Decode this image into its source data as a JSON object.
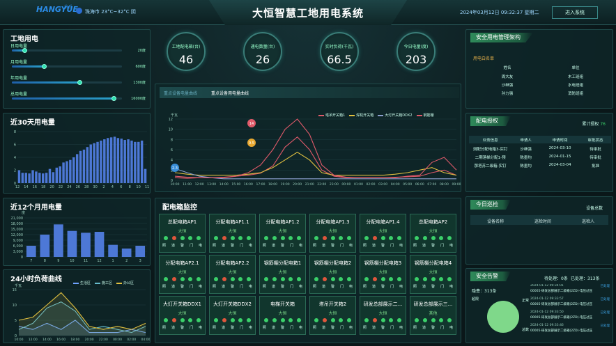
{
  "header": {
    "brand": "HANGYUE",
    "brand_cn": "杭岳",
    "weather": "珠海市 23°C~32°C 阴",
    "title": "大恒智慧工地用电系统",
    "datetime": "2024年03月12日 09:32:37 星期二",
    "enter_button": "进入系统"
  },
  "site_power": {
    "title": "工地用电",
    "rows": [
      {
        "label": "日用电量",
        "value": "20度",
        "fraction": 0.12
      },
      {
        "label": "月用电量",
        "value": "600度",
        "fraction": 0.3
      },
      {
        "label": "年用电量",
        "value": "1300度",
        "fraction": 0.62
      },
      {
        "label": "总用电量",
        "value": "16000度",
        "fraction": 0.93
      }
    ]
  },
  "daily30": {
    "title": "近30天用电量"
  },
  "monthly12": {
    "title": "近12个月用电量"
  },
  "load24": {
    "title": "24小时负荷曲线",
    "legend": [
      "生活区",
      "施工区",
      "办公区"
    ]
  },
  "gauges": [
    {
      "label": "工地配电箱(台)",
      "value": "46"
    },
    {
      "label": "通电数量(台)",
      "value": "26"
    },
    {
      "label": "实时负荷(千瓦)",
      "value": "66.5"
    },
    {
      "label": "今日电量(度)",
      "value": "203"
    }
  ],
  "trend": {
    "tabs": [
      "重点设备电量曲线",
      "重点设备用电量曲线"
    ],
    "unit": "千瓦",
    "legend": [
      "塔吊开关箱1",
      "焊机开关箱",
      "大灯开关箱DDX2",
      "钢筋棚"
    ],
    "markers": [
      "14",
      "9.5",
      "2.3"
    ]
  },
  "cabinets": {
    "title": "配电箱监控",
    "dot_labels": [
      "照",
      "道",
      "警",
      "门",
      "电"
    ],
    "items": [
      {
        "name": "总配电箱AP1",
        "status": "大恒"
      },
      {
        "name": "分配电箱AP1.1",
        "status": "大恒"
      },
      {
        "name": "分配电箱AP1.2",
        "status": "大恒"
      },
      {
        "name": "分配电箱AP1.3",
        "status": "大恒"
      },
      {
        "name": "分配电箱AP1.4",
        "status": "大恒"
      },
      {
        "name": "总配电箱AP2",
        "status": "大恒"
      },
      {
        "name": "分配电箱AP2.1",
        "status": "大恒"
      },
      {
        "name": "分配电箱AP2.2",
        "status": "大恒"
      },
      {
        "name": "钢筋棚分配电箱1",
        "status": "大恒"
      },
      {
        "name": "钢筋棚分配电箱2",
        "status": "大恒"
      },
      {
        "name": "钢筋棚分配电箱3",
        "status": "大恒"
      },
      {
        "name": "钢筋棚分配电箱4",
        "status": "大恒"
      },
      {
        "name": "大灯开关箱DDX1",
        "status": "大恒"
      },
      {
        "name": "大灯开关箱DDX2",
        "status": "大恒"
      },
      {
        "name": "电梯开关箱",
        "status": "大恒"
      },
      {
        "name": "塔吊开关箱2",
        "status": "大恒"
      },
      {
        "name": "研发总部展示二...",
        "status": "大恒"
      },
      {
        "name": "研发总部展示三...",
        "status": "其他"
      }
    ]
  },
  "safety_org": {
    "title": "安全用电管理架构",
    "whitelist": "用电白名单",
    "headers": [
      "姓名",
      "单位"
    ],
    "rows": [
      [
        "周大友",
        "木工班组"
      ],
      [
        "沙继强",
        "水电班组"
      ],
      [
        "孙力强",
        "消防班组"
      ]
    ]
  },
  "auth": {
    "title": "配电授权",
    "total_label": "累计授权",
    "total": "76",
    "headers": [
      "业务信息",
      "申请人",
      "申请时间",
      "审批状态"
    ],
    "rows": [
      [
        "测配分配电箱3-实钉",
        "沙继强",
        "2024-03-10",
        "待审批"
      ],
      [
        "二期落梯分配1-预",
        "陈墨均",
        "2024-01-15",
        "待审批"
      ],
      [
        "那塔苏二级箱-实钉",
        "陈墨均",
        "2024-03-04",
        "批准"
      ]
    ]
  },
  "patrol": {
    "title": "今日巡检",
    "status": "设备总数",
    "headers": [
      "设备名称",
      "巡检时间",
      "巡检人"
    ]
  },
  "alarm": {
    "title": "安全告警",
    "pending": "待处理：0条",
    "done": "已处理：313条",
    "total": "隐患：313条",
    "pie_labels": [
      "超限",
      "正常",
      "总数"
    ],
    "entries": [
      {
        "time": "2024-01-12 09:34:01",
        "text": "00005-研发总部展示二级箱(2ZD)-电压过压",
        "state": "已处理"
      },
      {
        "time": "2024-01-12 09:33:57",
        "text": "00005-研发总部展示二级箱(2ZD)-电压过压",
        "state": "已处理"
      },
      {
        "time": "2024-01-12 09:33:50",
        "text": "00005-研发总部展示二级箱(2ZD)-电压过压",
        "state": "已处理"
      },
      {
        "time": "2024-01-12 09:33:46",
        "text": "00005-研发总部展示二级箱(2ZD)-电压过压",
        "state": "已处理"
      }
    ]
  },
  "chart_data": [
    {
      "type": "bar",
      "title": "近30天用电量",
      "x": [
        "12",
        "14",
        "16",
        "18",
        "20",
        "22",
        "24",
        "26",
        "28",
        "30",
        "2",
        "4",
        "6",
        "8",
        "10",
        "11"
      ],
      "values": [
        2,
        1.6,
        1.6,
        1.5,
        2,
        1.8,
        1.6,
        1.5,
        1.6,
        2.2,
        1.7,
        2.4,
        2.6,
        3.2,
        3.4,
        3.6,
        4,
        4.5,
        5,
        5.2,
        5.6,
        6,
        6.2,
        6.4,
        6.6,
        6.8,
        7,
        7.1,
        7.2,
        7,
        6.9,
        6.7,
        6.8,
        6.6,
        6.4,
        6.4,
        6.6,
        2.2
      ],
      "ylim": [
        0,
        8
      ],
      "yticks": [
        "0",
        "2",
        "4",
        "6",
        "8"
      ]
    },
    {
      "type": "bar",
      "title": "近12个月用电量",
      "ylabel": "度",
      "categories": [
        "7",
        "8",
        "9",
        "10",
        "11",
        "12",
        "1",
        "2",
        "3"
      ],
      "values": [
        6000,
        12000,
        17500,
        14000,
        13000,
        13500,
        6500,
        4500,
        6000
      ],
      "ylim": [
        0,
        21000
      ],
      "yticks": [
        "0",
        "3,000",
        "6,000",
        "9,000",
        "12,000",
        "15,000",
        "18,000",
        "21,000"
      ]
    },
    {
      "type": "line",
      "title": "24小时负荷曲线",
      "ylabel": "千瓦",
      "x": [
        "10:00",
        "12:00",
        "14:00",
        "16:00",
        "18:00",
        "20:00",
        "22:00",
        "00:00",
        "02:00",
        "04:00"
      ],
      "ylim": [
        0,
        15
      ],
      "yticks": [
        "0",
        "5",
        "10",
        "15"
      ],
      "series": [
        {
          "name": "生活区",
          "values": [
            3,
            2,
            4,
            2,
            5,
            1,
            1,
            1,
            2,
            1
          ]
        },
        {
          "name": "施工区",
          "values": [
            2,
            4,
            9,
            11,
            8,
            2,
            3,
            2,
            1,
            3
          ]
        },
        {
          "name": "办公区",
          "values": [
            5,
            6,
            10,
            14,
            9,
            3,
            2,
            3,
            2,
            4
          ]
        }
      ]
    },
    {
      "type": "line",
      "title": "重点设备用电量曲线",
      "ylabel": "千瓦",
      "x": [
        "10:00",
        "11:00",
        "12:00",
        "13:00",
        "14:00",
        "15:00",
        "16:00",
        "17:00",
        "18:00",
        "19:00",
        "20:00",
        "21:00",
        "22:00",
        "23:00",
        "00:00",
        "01:00",
        "02:00",
        "03:00",
        "04:00",
        "05:00",
        "06:00",
        "07:00",
        "08:00",
        "09:00"
      ],
      "ylim": [
        0,
        12
      ],
      "yticks": [
        "0",
        "2",
        "4",
        "6",
        "8",
        "10",
        "12"
      ],
      "series": [
        {
          "name": "塔吊开关箱1",
          "values": [
            0.5,
            0.4,
            0.5,
            0.5,
            0.6,
            0.8,
            1,
            1.4,
            2.8,
            6.5,
            8.5,
            6,
            2,
            0.8,
            0.5,
            0.5,
            0.5,
            0.5,
            0.6,
            0.7,
            0.8,
            1.5,
            2,
            1
          ]
        },
        {
          "name": "焊机开关箱",
          "values": [
            1.5,
            1.2,
            1,
            1,
            1,
            1,
            1.2,
            1.5,
            2.5,
            4,
            5.5,
            4,
            1.5,
            1,
            1,
            1,
            1,
            1,
            1.2,
            1.5,
            2,
            2.5,
            1.5,
            1
          ]
        },
        {
          "name": "大灯开关箱DDX2",
          "values": [
            2.3,
            1.5,
            0.8,
            0.5,
            0.3,
            0.3,
            0.3,
            0.3,
            0.3,
            0.3,
            0.3,
            0.3,
            0.3,
            0.3,
            0.3,
            0.3,
            0.3,
            0.3,
            0.3,
            0.3,
            0.3,
            0.3,
            0.3,
            0.3
          ]
        },
        {
          "name": "钢筋棚",
          "values": [
            0.8,
            0.6,
            0.5,
            0.5,
            0.5,
            0.8,
            1.5,
            3,
            6,
            10,
            12,
            9,
            3,
            1,
            0.6,
            0.5,
            0.5,
            0.5,
            0.5,
            0.8,
            1,
            3.5,
            4.5,
            2
          ]
        }
      ]
    }
  ],
  "colors": {
    "accent": "#2ee0b0",
    "line1": "#6fa3ff",
    "line2": "#e0c040",
    "line3": "#8ca0d0",
    "line4": "#e05a6a"
  }
}
